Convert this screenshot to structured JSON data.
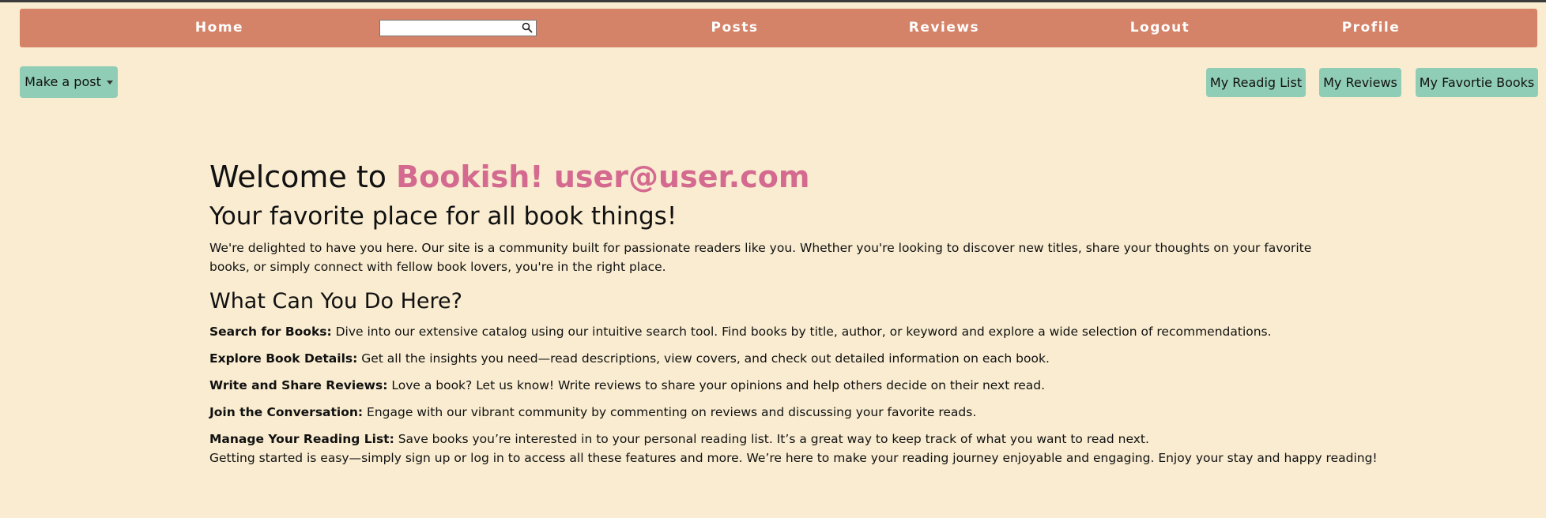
{
  "navbar": {
    "home": "Home",
    "posts": "Posts",
    "reviews": "Reviews",
    "logout": "Logout",
    "profile": "Profile",
    "search_value": "",
    "search_placeholder": ""
  },
  "toolbar": {
    "make_post": "Make a post",
    "reading_list": "My Readig List",
    "my_reviews": "My Reviews",
    "favorite_books": "My Favortie Books"
  },
  "main": {
    "welcome_prefix": "Welcome to ",
    "brand": "Bookish!",
    "user_email": "user@user.com",
    "tagline": "Your favorite place for all book things!",
    "intro": "We're delighted to have you here. Our site is a community built for passionate readers like you. Whether you're looking to discover new titles, share your thoughts on your favorite books, or simply connect with fellow book lovers, you're in the right place.",
    "section_title": "What Can You Do Here?",
    "features": [
      {
        "title": "Search for Books:",
        "text": " Dive into our extensive catalog using our intuitive search tool. Find books by title, author, or keyword and explore a wide selection of recommendations."
      },
      {
        "title": "Explore Book Details:",
        "text": " Get all the insights you need—read descriptions, view covers, and check out detailed information on each book."
      },
      {
        "title": "Write and Share Reviews:",
        "text": " Love a book? Let us know! Write reviews to share your opinions and help others decide on their next read."
      },
      {
        "title": "Join the Conversation:",
        "text": " Engage with our vibrant community by commenting on reviews and discussing your favorite reads."
      },
      {
        "title": "Manage Your Reading List:",
        "text": " Save books you’re interested in to your personal reading list. It’s a great way to keep track of what you want to read next."
      }
    ],
    "closing": "Getting started is easy—simply sign up or log in to access all these features and more. We’re here to make your reading journey enjoyable and engaging. Enjoy your stay and happy reading!"
  },
  "colors": {
    "background": "#f9ecd0",
    "navbar": "#d58368",
    "button": "#8fcdb6",
    "brand_pink": "#d46a8f"
  },
  "icons": {
    "search": "search-icon",
    "dropdown": "caret-down-icon"
  }
}
